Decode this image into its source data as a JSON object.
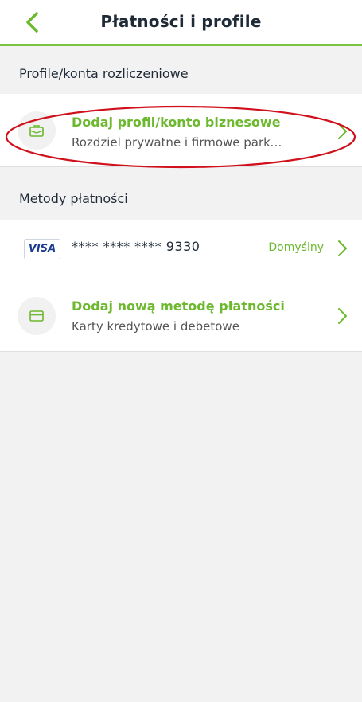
{
  "header": {
    "title": "Płatności i profile",
    "back_icon": "chevron-left-icon",
    "accent_color": "#7cc243"
  },
  "profiles": {
    "section_label": "Profile/konta rozliczeniowe",
    "add_business": {
      "icon": "briefcase-icon",
      "title": "Dodaj profil/konto biznesowe",
      "subtitle": "Rozdziel prywatne i firmowe parkowanie"
    }
  },
  "payments": {
    "section_label": "Metody płatności",
    "card": {
      "brand": "VISA",
      "masked_number": "**** **** **** 9330",
      "default_label": "Domyślny"
    },
    "add_method": {
      "icon": "credit-card-icon",
      "title": "Dodaj nową metodę płatności",
      "subtitle": "Karty kredytowe i debetowe"
    }
  },
  "annotation": {
    "highlight_color": "#d0101a"
  }
}
